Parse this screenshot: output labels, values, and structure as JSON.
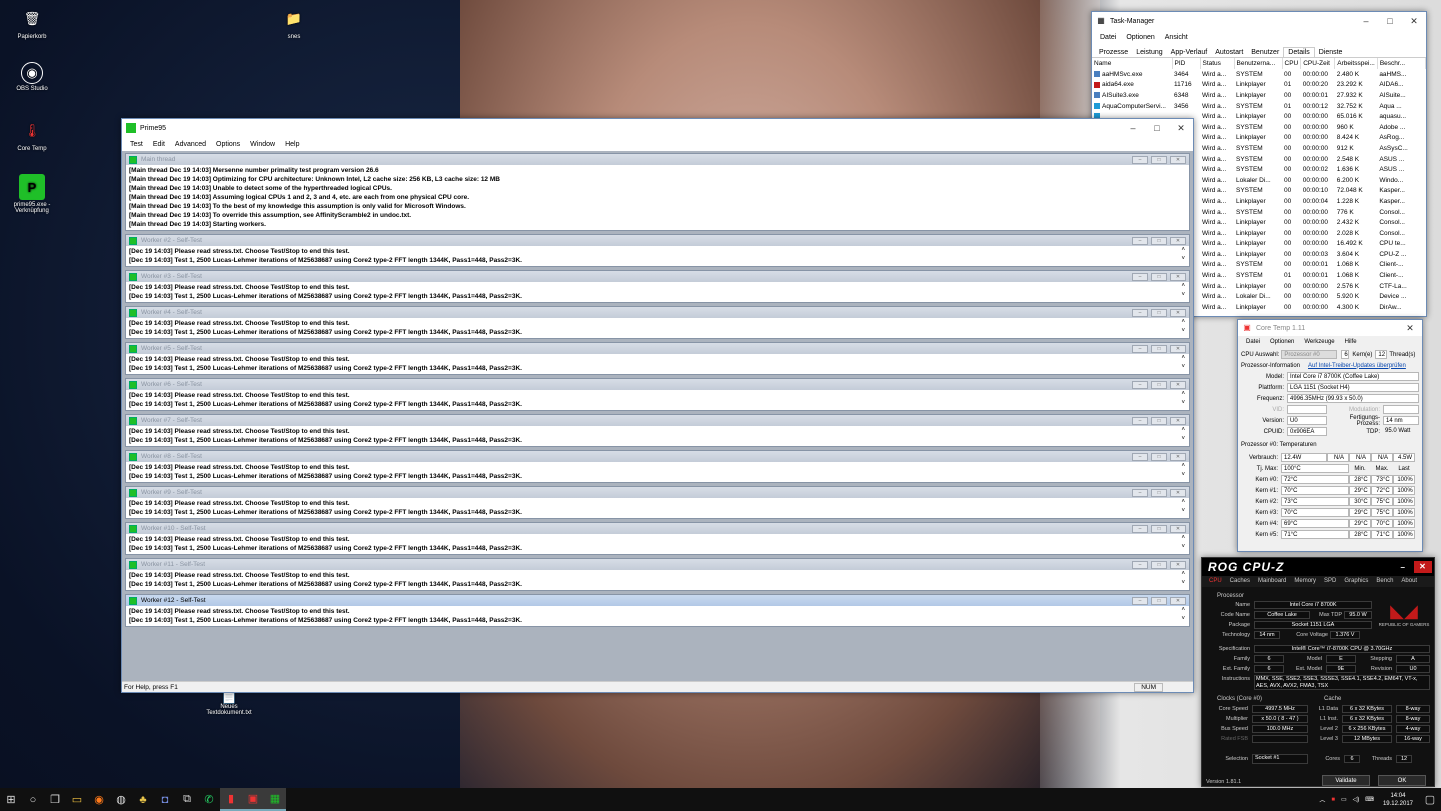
{
  "desktop": {
    "icons": [
      {
        "label": "Papierkorb",
        "icon": "recycle-bin-icon",
        "glyph": "🗑"
      },
      {
        "label": "OBS Studio",
        "icon": "obs-icon",
        "glyph": "◉"
      },
      {
        "label": "Core Temp",
        "icon": "core-temp-icon",
        "glyph": "🌡"
      },
      {
        "label": "prime95.exe - Verknüpfung",
        "icon": "prime95-icon",
        "glyph": "P"
      },
      {
        "label": "snes",
        "icon": "folder-icon",
        "glyph": "📁"
      },
      {
        "label": "Neues Textdokument.txt",
        "icon": "text-file-icon",
        "glyph": "📄"
      }
    ]
  },
  "task_manager": {
    "title": "Task-Manager",
    "menu": [
      "Datei",
      "Optionen",
      "Ansicht"
    ],
    "tabs": [
      "Prozesse",
      "Leistung",
      "App-Verlauf",
      "Autostart",
      "Benutzer",
      "Details",
      "Dienste"
    ],
    "active_tab": "Details",
    "columns": [
      "Name",
      "PID",
      "Status",
      "Benutzerna...",
      "CPU",
      "CPU-Zeit",
      "Arbeitsspei...",
      "Beschr..."
    ],
    "rows": [
      [
        "aaHMSvc.exe",
        "3464",
        "Wird a...",
        "SYSTEM",
        "00",
        "00:00:00",
        "2.480 K",
        "aaHMS..."
      ],
      [
        "aida64.exe",
        "11716",
        "Wird a...",
        "Linkplayer",
        "01",
        "00:00:20",
        "23.292 K",
        "AIDA6..."
      ],
      [
        "AISuite3.exe",
        "6348",
        "Wird a...",
        "Linkplayer",
        "00",
        "00:00:01",
        "27.932 K",
        "AISuite..."
      ],
      [
        "AquaComputerServi...",
        "3456",
        "Wird a...",
        "SYSTEM",
        "01",
        "00:00:12",
        "32.752 K",
        "Aqua ..."
      ],
      [
        "",
        "",
        "Wird a...",
        "Linkplayer",
        "00",
        "00:00:00",
        "65.016 K",
        "aquasu..."
      ],
      [
        "",
        "",
        "Wird a...",
        "SYSTEM",
        "00",
        "00:00:00",
        "960 K",
        "Adobe ..."
      ],
      [
        "",
        "",
        "Wird a...",
        "Linkplayer",
        "00",
        "00:00:00",
        "8.424 K",
        "AsRog..."
      ],
      [
        "",
        "",
        "Wird a...",
        "SYSTEM",
        "00",
        "00:00:00",
        "912 K",
        "AsSysC..."
      ],
      [
        "",
        "",
        "Wird a...",
        "SYSTEM",
        "00",
        "00:00:00",
        "2.548 K",
        "ASUS ..."
      ],
      [
        "",
        "",
        "Wird a...",
        "SYSTEM",
        "00",
        "00:00:02",
        "1.636 K",
        "ASUS ..."
      ],
      [
        "",
        "",
        "Wird a...",
        "Lokaler Di...",
        "00",
        "00:00:00",
        "6.200 K",
        "Windo..."
      ],
      [
        "",
        "",
        "Wird a...",
        "SYSTEM",
        "00",
        "00:00:10",
        "72.048 K",
        "Kasper..."
      ],
      [
        "",
        "",
        "Wird a...",
        "Linkplayer",
        "00",
        "00:00:04",
        "1.228 K",
        "Kasper..."
      ],
      [
        "",
        "",
        "Wird a...",
        "SYSTEM",
        "00",
        "00:00:00",
        "776 K",
        "Consol..."
      ],
      [
        "",
        "",
        "Wird a...",
        "Linkplayer",
        "00",
        "00:00:00",
        "2.432 K",
        "Consol..."
      ],
      [
        "",
        "",
        "Wird a...",
        "Linkplayer",
        "00",
        "00:00:00",
        "2.028 K",
        "Consol..."
      ],
      [
        "",
        "",
        "Wird a...",
        "Linkplayer",
        "00",
        "00:00:00",
        "16.492 K",
        "CPU te..."
      ],
      [
        "",
        "",
        "Wird a...",
        "Linkplayer",
        "00",
        "00:00:03",
        "3.604 K",
        "CPU-Z ..."
      ],
      [
        "",
        "",
        "Wird a...",
        "SYSTEM",
        "00",
        "00:00:01",
        "1.068 K",
        "Client-..."
      ],
      [
        "",
        "",
        "Wird a...",
        "SYSTEM",
        "01",
        "00:00:01",
        "1.068 K",
        "Client-..."
      ],
      [
        "",
        "",
        "Wird a...",
        "Linkplayer",
        "00",
        "00:00:00",
        "2.576 K",
        "CTF-La..."
      ],
      [
        "",
        "",
        "Wird a...",
        "Lokaler Di...",
        "00",
        "00:00:00",
        "5.920 K",
        "Device ..."
      ],
      [
        "",
        "",
        "Wird a...",
        "Linkplayer",
        "00",
        "00:00:00",
        "4.300 K",
        "DirAw..."
      ]
    ]
  },
  "prime95": {
    "title": "Prime95",
    "menu": [
      "Test",
      "Edit",
      "Advanced",
      "Options",
      "Window",
      "Help"
    ],
    "main_thread": {
      "title": "Main thread",
      "lines": [
        "[Main thread Dec 19 14:03] Mersenne number primality test program version 26.6",
        "[Main thread Dec 19 14:03] Optimizing for CPU architecture: Unknown Intel, L2 cache size: 256 KB, L3 cache size: 12 MB",
        "[Main thread Dec 19 14:03] Unable to detect some of the hyperthreaded logical CPUs.",
        "[Main thread Dec 19 14:03] Assuming logical CPUs 1 and 2, 3 and 4, etc. are each from one physical CPU core.",
        "[Main thread Dec 19 14:03] To the best of my knowledge this assumption is only valid for Microsoft Windows.",
        "[Main thread Dec 19 14:03] To override this assumption, see AffinityScramble2 in undoc.txt.",
        "[Main thread Dec 19 14:03] Starting workers."
      ]
    },
    "workers": [
      {
        "title": "Worker #2 - Self-Test",
        "lines": [
          "[Dec 19 14:03] Please read stress.txt.  Choose Test/Stop to end this test.",
          "[Dec 19 14:03] Test 1, 2500 Lucas-Lehmer iterations of M25638687 using Core2 type-2 FFT length 1344K, Pass1=448, Pass2=3K."
        ]
      },
      {
        "title": "Worker #3 - Self-Test",
        "lines": [
          "[Dec 19 14:03] Please read stress.txt.  Choose Test/Stop to end this test.",
          "[Dec 19 14:03] Test 1, 2500 Lucas-Lehmer iterations of M25638687 using Core2 type-2 FFT length 1344K, Pass1=448, Pass2=3K."
        ]
      },
      {
        "title": "Worker #4 - Self-Test",
        "lines": [
          "[Dec 19 14:03] Please read stress.txt.  Choose Test/Stop to end this test.",
          "[Dec 19 14:03] Test 1, 2500 Lucas-Lehmer iterations of M25638687 using Core2 type-2 FFT length 1344K, Pass1=448, Pass2=3K."
        ]
      },
      {
        "title": "Worker #5 - Self-Test",
        "lines": [
          "[Dec 19 14:03] Please read stress.txt.  Choose Test/Stop to end this test.",
          "[Dec 19 14:03] Test 1, 2500 Lucas-Lehmer iterations of M25638687 using Core2 type-2 FFT length 1344K, Pass1=448, Pass2=3K."
        ]
      },
      {
        "title": "Worker #6 - Self-Test",
        "lines": [
          "[Dec 19 14:03] Please read stress.txt.  Choose Test/Stop to end this test.",
          "[Dec 19 14:03] Test 1, 2500 Lucas-Lehmer iterations of M25638687 using Core2 type-2 FFT length 1344K, Pass1=448, Pass2=3K."
        ]
      },
      {
        "title": "Worker #7 - Self-Test",
        "lines": [
          "[Dec 19 14:03] Please read stress.txt.  Choose Test/Stop to end this test.",
          "[Dec 19 14:03] Test 1, 2500 Lucas-Lehmer iterations of M25638687 using Core2 type-2 FFT length 1344K, Pass1=448, Pass2=3K."
        ]
      },
      {
        "title": "Worker #8 - Self-Test",
        "lines": [
          "[Dec 19 14:03] Please read stress.txt.  Choose Test/Stop to end this test.",
          "[Dec 19 14:03] Test 1, 2500 Lucas-Lehmer iterations of M25638687 using Core2 type-2 FFT length 1344K, Pass1=448, Pass2=3K."
        ]
      },
      {
        "title": "Worker #9 - Self-Test",
        "lines": [
          "[Dec 19 14:03] Please read stress.txt.  Choose Test/Stop to end this test.",
          "[Dec 19 14:03] Test 1, 2500 Lucas-Lehmer iterations of M25638687 using Core2 type-2 FFT length 1344K, Pass1=448, Pass2=3K."
        ]
      },
      {
        "title": "Worker #10 - Self-Test",
        "lines": [
          "[Dec 19 14:03] Please read stress.txt.  Choose Test/Stop to end this test.",
          "[Dec 19 14:03] Test 1, 2500 Lucas-Lehmer iterations of M25638687 using Core2 type-2 FFT length 1344K, Pass1=448, Pass2=3K."
        ]
      },
      {
        "title": "Worker #11 - Self-Test",
        "lines": [
          "[Dec 19 14:03] Please read stress.txt.  Choose Test/Stop to end this test.",
          "[Dec 19 14:03] Test 1, 2500 Lucas-Lehmer iterations of M25638687 using Core2 type-2 FFT length 1344K, Pass1=448, Pass2=3K."
        ]
      },
      {
        "title": "Worker #12 - Self-Test",
        "lines": [
          "[Dec 19 14:03] Please read stress.txt.  Choose Test/Stop to end this test.",
          "[Dec 19 14:03] Test 1, 2500 Lucas-Lehmer iterations of M25638687 using Core2 type-2 FFT length 1344K, Pass1=448, Pass2=3K."
        ]
      }
    ],
    "active_worker_index": 10,
    "status_text": "For Help, press F1",
    "status_num": "NUM"
  },
  "core_temp": {
    "title": "Core Temp 1.11",
    "menu": [
      "Datei",
      "Optionen",
      "Werkzeuge",
      "Hilfe"
    ],
    "cpu_select_label": "CPU Auswahl:",
    "cpu_select_value": "Prozessor #0",
    "cores_value": "6",
    "cores_label": "Kern(e)",
    "threads_value": "12",
    "threads_label": "Thread(s)",
    "info_label": "Prozessor-Information",
    "update_link": "Auf Intel-Treiber-Updates überprüfen",
    "fields": [
      {
        "label": "Model:",
        "value": "Intel Core i7 8700K (Coffee Lake)"
      },
      {
        "label": "Plattform:",
        "value": "LGA 1151 (Socket H4)"
      },
      {
        "label": "Frequenz:",
        "value": "4996.35MHz (99.93 x 50.0)"
      }
    ],
    "vid_label": "VID:",
    "modulation_label": "Modulation:",
    "version_label": "Version:",
    "version_value": "U0",
    "process_label": "Fertigungs-Prozess:",
    "process_value": "14 nm",
    "cpuid_label": "CPUID:",
    "cpuid_value": "0x906EA",
    "tdp_label": "TDP:",
    "tdp_value": "95.0 Watt",
    "temps_label": "Prozessor #0: Temperaturen",
    "power_label": "Verbrauch:",
    "power_values": [
      "12.4W",
      "N/A",
      "N/A",
      "N/A",
      "4.5W"
    ],
    "tjmax_label": "Tj. Max:",
    "tjmax_value": "100°C",
    "col_min": "Min.",
    "col_max": "Max.",
    "col_last": "Last",
    "cores": [
      {
        "label": "Kern #0:",
        "temp": "72°C",
        "min": "28°C",
        "max": "73°C",
        "load": "100%"
      },
      {
        "label": "Kern #1:",
        "temp": "70°C",
        "min": "29°C",
        "max": "72°C",
        "load": "100%"
      },
      {
        "label": "Kern #2:",
        "temp": "73°C",
        "min": "30°C",
        "max": "75°C",
        "load": "100%"
      },
      {
        "label": "Kern #3:",
        "temp": "70°C",
        "min": "29°C",
        "max": "75°C",
        "load": "100%"
      },
      {
        "label": "Kern #4:",
        "temp": "69°C",
        "min": "29°C",
        "max": "70°C",
        "load": "100%"
      },
      {
        "label": "Kern #5:",
        "temp": "71°C",
        "min": "28°C",
        "max": "71°C",
        "load": "100%"
      }
    ]
  },
  "cpuz": {
    "title": "ROG CPU-Z",
    "tabs": [
      "CPU",
      "Caches",
      "Mainboard",
      "Memory",
      "SPD",
      "Graphics",
      "Bench",
      "About"
    ],
    "processor_label": "Processor",
    "name_label": "Name",
    "name": "Intel Core i7 8700K",
    "codename_label": "Code Name",
    "codename": "Coffee Lake",
    "maxtdp_label": "Max TDP",
    "maxtdp": "95.0 W",
    "package_label": "Package",
    "package": "Socket 1151 LGA",
    "tech_label": "Technology",
    "tech": "14 nm",
    "voltage_label": "Core Voltage",
    "voltage": "1.376 V",
    "spec_label": "Specification",
    "spec": "Intel® Core™ i7-8700K CPU @ 3.70GHz",
    "family_label": "Family",
    "family": "6",
    "model_label": "Model",
    "model": "E",
    "stepping_label": "Stepping",
    "stepping": "A",
    "extfamily_label": "Ext. Family",
    "extfamily": "6",
    "extmodel_label": "Ext. Model",
    "extmodel": "9E",
    "revision_label": "Revision",
    "revision": "U0",
    "instr_label": "Instructions",
    "instr": "MMX, SSE, SSE2, SSE3, SSSE3, SSE4.1, SSE4.2, EM64T, VT-x, AES, AVX, AVX2, FMA3, TSX",
    "clocks_label": "Clocks (Core #0)",
    "corespeed_label": "Core Speed",
    "corespeed": "4997.5 MHz",
    "multiplier_label": "Multiplier",
    "multiplier": "x 50.0 ( 8 - 47 )",
    "busspeed_label": "Bus Speed",
    "busspeed": "100.0 MHz",
    "ratedfsb_label": "Rated FSB",
    "cache_label": "Cache",
    "l1d_label": "L1 Data",
    "l1d": "6 x 32 KBytes",
    "l1d_way": "8-way",
    "l1i_label": "L1 Inst.",
    "l1i": "6 x 32 KBytes",
    "l1i_way": "8-way",
    "l2_label": "Level 2",
    "l2": "6 x 256 KBytes",
    "l2_way": "4-way",
    "l3_label": "Level 3",
    "l3": "12 MBytes",
    "l3_way": "16-way",
    "selection_label": "Selection",
    "selection": "Socket #1",
    "cores_label": "Cores",
    "cores": "6",
    "threads_label": "Threads",
    "threads": "12",
    "version": "Version 1.81.1",
    "validate": "Validate",
    "ok": "OK",
    "logo_text": "REPUBLIC OF GAMERS"
  },
  "taskbar": {
    "time": "14:04",
    "date": "19.12.2017"
  }
}
